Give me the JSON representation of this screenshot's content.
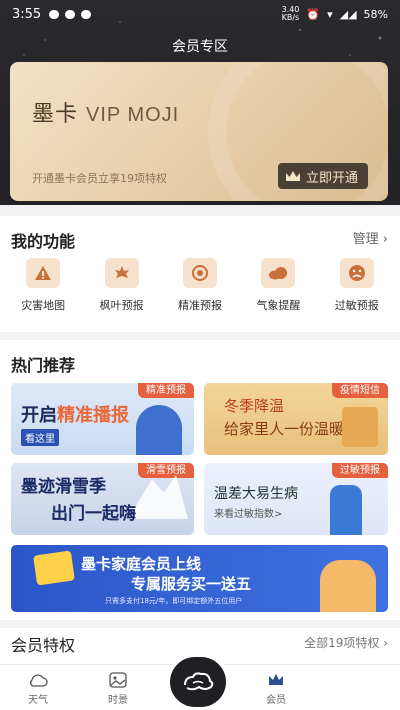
{
  "status_bar": {
    "time": "3:55",
    "network_speed": "3.40\nKB/s",
    "battery": "58%"
  },
  "header": {
    "title": "会员专区"
  },
  "vip_card": {
    "name": "墨卡",
    "name_latin": "VIP MOJI",
    "subtitle": "开通墨卡会员立享19项特权",
    "button_label": "立即开通"
  },
  "my_functions": {
    "title": "我的功能",
    "manage_label": "管理 ›",
    "items": [
      {
        "label": "灾害地图",
        "icon": "warning-icon"
      },
      {
        "label": "枫叶预报",
        "icon": "maple-leaf-icon"
      },
      {
        "label": "精准预报",
        "icon": "target-icon"
      },
      {
        "label": "气象提醒",
        "icon": "cloud-icon"
      },
      {
        "label": "过敏预报",
        "icon": "allergy-face-icon"
      }
    ]
  },
  "hot": {
    "title": "热门推荐",
    "cards": [
      {
        "tag": "精准预报",
        "title_a": "开启",
        "title_b": "精准播报",
        "sub": "看这里"
      },
      {
        "tag": "疫情短信",
        "line1": "冬季降温",
        "line2": "给家里人一份温暖"
      },
      {
        "tag": "滑雪预报",
        "line1": "墨迹滑雪季",
        "line2": "出门一起嗨"
      },
      {
        "tag": "过敏预报",
        "line1": "温差大易生病",
        "line2": "来看过敏指数>"
      }
    ],
    "banner": {
      "line1": "墨卡家庭会员上线",
      "line2": "专属服务买一送五",
      "line3": "只需多支付18元/年，即可绑定额外五位用户"
    }
  },
  "privileges": {
    "title": "会员特权",
    "link": "全部19项特权 ›"
  },
  "nav": {
    "items": [
      {
        "label": "天气",
        "icon": "cloud-icon"
      },
      {
        "label": "时景",
        "icon": "image-icon"
      },
      {
        "label": "",
        "icon": "moji-logo-icon"
      },
      {
        "label": "会员",
        "icon": "crown-icon"
      },
      {
        "label": "",
        "icon": ""
      }
    ]
  },
  "colors": {
    "accent": "#e4603e",
    "gold": "#e8d1ad",
    "dark": "#2a2a2e"
  }
}
